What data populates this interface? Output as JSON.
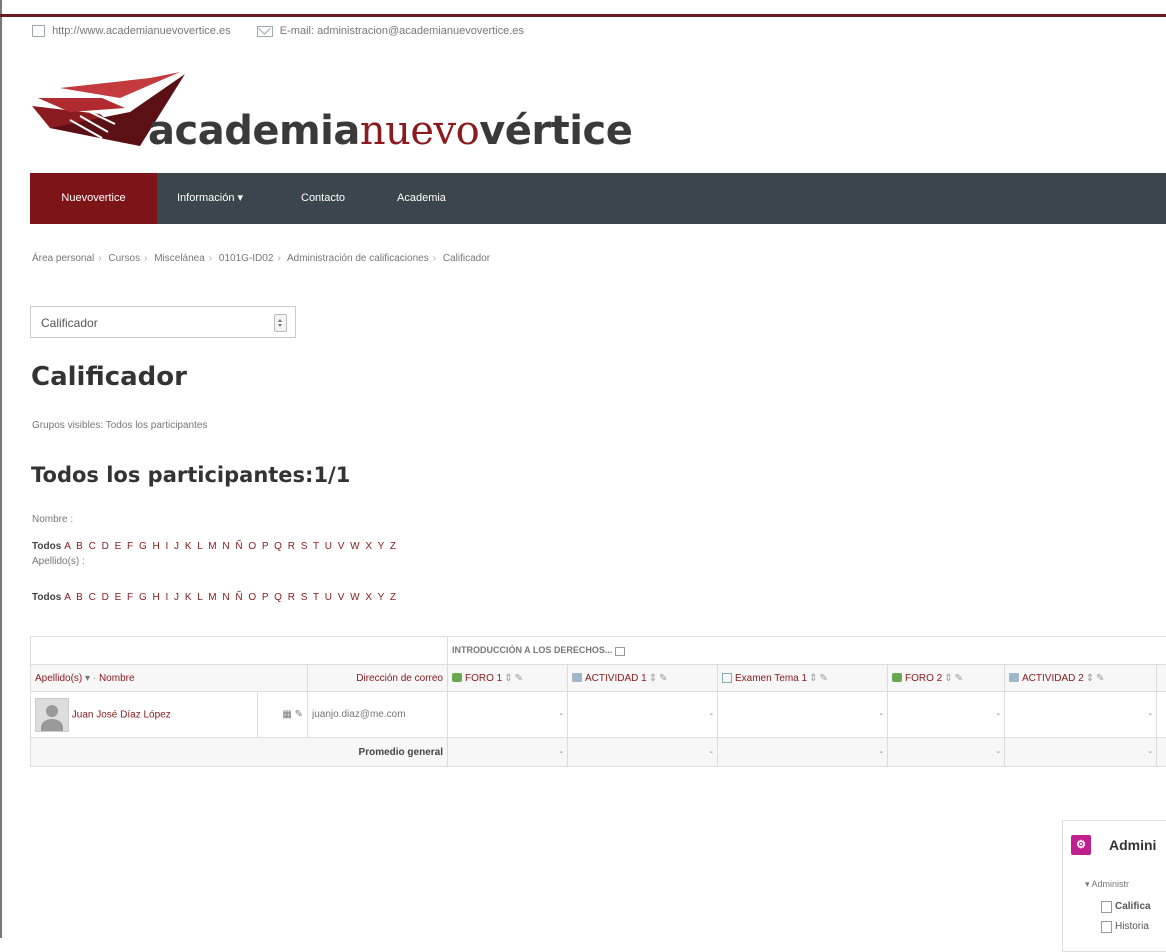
{
  "site": {
    "url": "http://www.academianuevovertice.es",
    "email": "E-mail: administracion@academianuevovertice.es",
    "logo_part1": "academia",
    "logo_part2": "nuevo",
    "logo_part3": "vértice"
  },
  "nav": {
    "items": [
      "Nuevovertice",
      "Información ▾",
      "Contacto",
      "Academia"
    ]
  },
  "breadcrumb": [
    "Área personal",
    "Cursos",
    "Miscelánea",
    "0101G-ID02",
    "Administración de calificaciones",
    "Calificador"
  ],
  "view_select": {
    "value": "Calificador"
  },
  "page_title": "Calificador",
  "groups_text": "Grupos visibles: Todos los participantes",
  "participants_heading": "Todos los participantes:1/1",
  "first_name_label": "Nombre :",
  "surname_label": "Apellido(s) :",
  "alphabet": {
    "all": "Todos",
    "letters": "A B C D E F G H I J K L M N Ñ O P Q R S T U V W X Y Z"
  },
  "grader_table": {
    "category": "INTRODUCCIÓN A LOS DERECHOS...",
    "col_surname": "Apellido(s)",
    "col_name": "Nombre",
    "col_email": "Dirección de correo",
    "items": [
      {
        "label": "FORO 1",
        "icon": "forum-icon"
      },
      {
        "label": "ACTIVIDAD 1",
        "icon": "assignment-icon"
      },
      {
        "label": "Examen Tema 1",
        "icon": "quiz-icon"
      },
      {
        "label": "FORO 2",
        "icon": "forum-icon"
      },
      {
        "label": "ACTIVIDAD 2",
        "icon": "assignment-icon"
      }
    ],
    "student": {
      "name": "Juan José Díaz López",
      "email": "juanjo.diaz@me.com",
      "grades": [
        "-",
        "-",
        "-",
        "-",
        "-"
      ]
    },
    "overall_label": "Promedio general",
    "overall": [
      "-",
      "-",
      "-",
      "-",
      "-"
    ]
  },
  "admin_block": {
    "title": "Admini",
    "sub": "▾ Administr",
    "links": [
      "Califica",
      "Historia"
    ]
  },
  "colors": {
    "brand_dark_red": "#7c1418",
    "nav_bg": "#3b454c",
    "link": "#8a1c20",
    "admin_icon": "#c0208f"
  }
}
